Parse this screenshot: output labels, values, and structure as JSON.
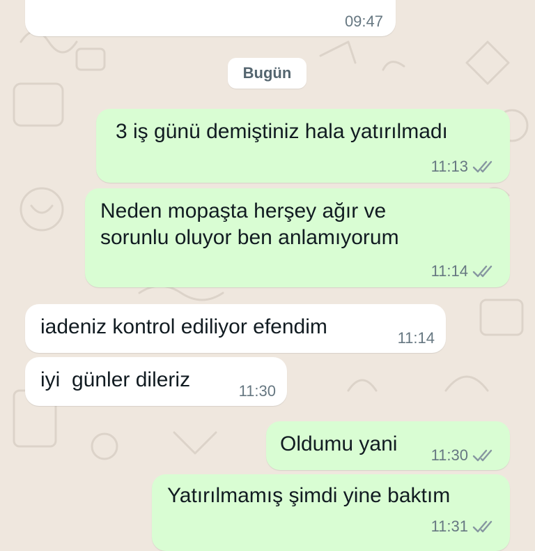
{
  "date_divider": "Bugün",
  "messages": [
    {
      "direction": "in",
      "text": "",
      "time": "09:47"
    },
    {
      "direction": "out",
      "text": "3 iş günü demiştiniz hala yatırılmadı",
      "time": "11:13",
      "status_icon": "double-check-icon"
    },
    {
      "direction": "out",
      "line1": "Neden mopaşta herşey ağır ve",
      "line2": "sorunlu oluyor ben anlamıyorum",
      "time": "11:14",
      "status_icon": "double-check-icon"
    },
    {
      "direction": "in",
      "text": "iadeniz kontrol ediliyor efendim",
      "time": "11:14"
    },
    {
      "direction": "in",
      "text": "iyi  günler dileriz",
      "time": "11:30"
    },
    {
      "direction": "out",
      "text": "Oldumu yani",
      "time": "11:30",
      "status_icon": "double-check-icon"
    },
    {
      "direction": "out",
      "text": "Yatırılmamış şimdi yine baktım",
      "time": "11:31",
      "status_icon": "double-check-icon"
    }
  ],
  "colors": {
    "wallpaper": "#EFE7DE",
    "incoming_bubble": "#FFFFFF",
    "outgoing_bubble": "#D9FDD3",
    "timestamp": "#667781",
    "tick_delivered": "#8696A0"
  }
}
